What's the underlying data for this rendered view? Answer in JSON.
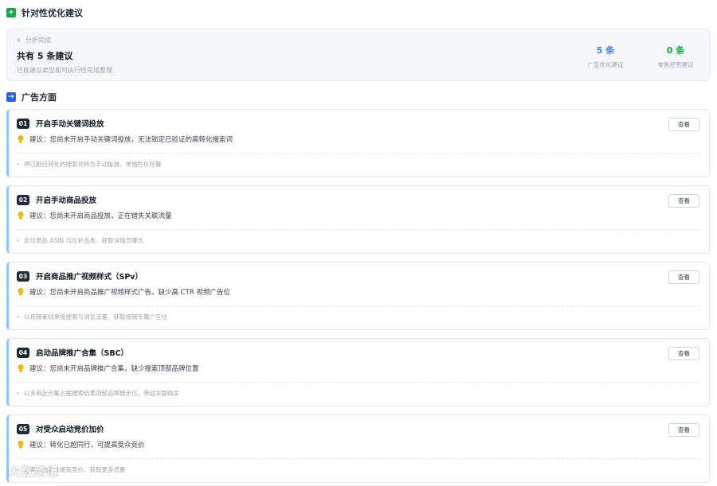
{
  "header": {
    "title": "针对性优化建议"
  },
  "summary": {
    "status": "分析完成",
    "total": "共有 5 条建议",
    "desc": "已按建议类型和可执行性完成整理",
    "stats": [
      {
        "num": "5 条",
        "label": "广告优化建议"
      },
      {
        "num": "0 条",
        "label": "零售经营建议"
      }
    ]
  },
  "ads_section": {
    "title": "广告方面"
  },
  "view_label": "查看",
  "cards": [
    {
      "index": "01",
      "title": "开启手动关键词投放",
      "suggestion": "建议：您尚未开启手动关键词投放，无法锁定已验证的高转化搜索词",
      "detail": "将已跑出转化的搜索词转为手动投放，单独控价控量"
    },
    {
      "index": "02",
      "title": "开启手动商品投放",
      "suggestion": "建议：您尚未开启商品投放，正在错失关联流量",
      "detail": "定位竞品 ASIN 与互补品类，获取详情页曝光"
    },
    {
      "index": "03",
      "title": "开启商品推广视频样式（SPv）",
      "suggestion": "建议：您尚未开启商品推广视频样式广告，缺少高 CTR 视频广告位",
      "detail": "以视频素材承接搜索与浏览流量，获取视频专属广告位"
    },
    {
      "index": "04",
      "title": "启动品牌推广合集（SBC）",
      "suggestion": "建议：您尚未开启品牌推广合集，缺少搜索顶部品牌位置",
      "detail": "以多商品合集占据搜索结果顶部品牌展示位，带动关联购买"
    },
    {
      "index": "05",
      "title": "对受众启动竞价加价",
      "suggestion": "建议：转化已超同行，可提高受众竞价",
      "detail": "对高转化受众提高竞价，获取更多流量"
    }
  ],
  "watermark": "大数跨境"
}
